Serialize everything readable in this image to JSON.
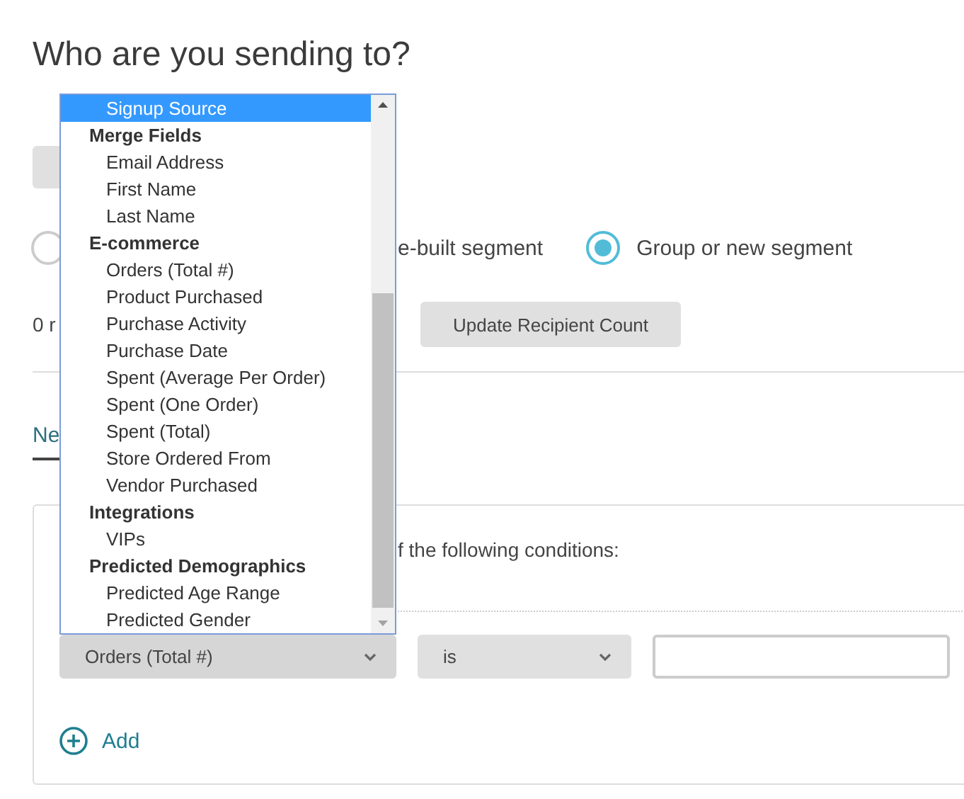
{
  "heading": "Who are you sending to?",
  "audience_options": [
    {
      "label": "e-built segment",
      "selected": false
    },
    {
      "label": "Group or new segment",
      "selected": true
    }
  ],
  "recipient_count": "0 r",
  "update_button": "Update Recipient Count",
  "tabs": [
    {
      "label": "Ne",
      "selected": true
    }
  ],
  "conditions": {
    "match_text": "f the following conditions:",
    "field_select": "Orders (Total #)",
    "operator_select": "is",
    "add_button": "Add"
  },
  "dropdown": {
    "items": [
      {
        "kind": "option",
        "label": "Signup Source",
        "selected": true
      },
      {
        "kind": "group",
        "label": "Merge Fields"
      },
      {
        "kind": "option",
        "label": "Email Address",
        "selected": false
      },
      {
        "kind": "option",
        "label": "First Name",
        "selected": false
      },
      {
        "kind": "option",
        "label": "Last Name",
        "selected": false
      },
      {
        "kind": "group",
        "label": "E-commerce"
      },
      {
        "kind": "option",
        "label": "Orders (Total #)",
        "selected": false
      },
      {
        "kind": "option",
        "label": "Product Purchased",
        "selected": false
      },
      {
        "kind": "option",
        "label": "Purchase Activity",
        "selected": false
      },
      {
        "kind": "option",
        "label": "Purchase Date",
        "selected": false
      },
      {
        "kind": "option",
        "label": "Spent (Average Per Order)",
        "selected": false
      },
      {
        "kind": "option",
        "label": "Spent (One Order)",
        "selected": false
      },
      {
        "kind": "option",
        "label": "Spent (Total)",
        "selected": false
      },
      {
        "kind": "option",
        "label": "Store Ordered From",
        "selected": false
      },
      {
        "kind": "option",
        "label": "Vendor Purchased",
        "selected": false
      },
      {
        "kind": "group",
        "label": "Integrations"
      },
      {
        "kind": "option",
        "label": "VIPs",
        "selected": false
      },
      {
        "kind": "group",
        "label": "Predicted Demographics"
      },
      {
        "kind": "option",
        "label": "Predicted Age Range",
        "selected": false
      },
      {
        "kind": "option",
        "label": "Predicted Gender",
        "selected": false
      }
    ]
  }
}
